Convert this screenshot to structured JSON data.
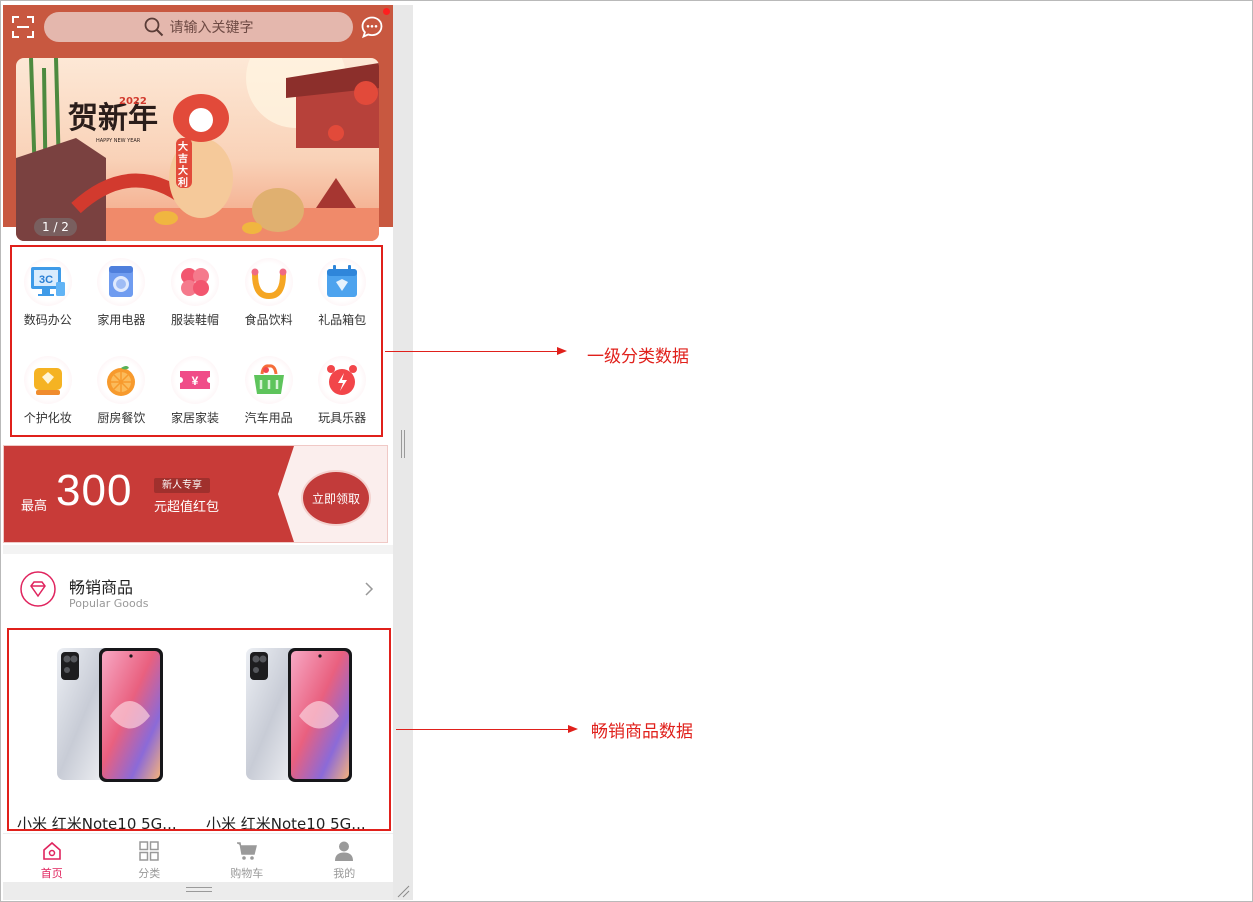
{
  "search": {
    "placeholder": "请输入关键字"
  },
  "banner": {
    "indicator": "1 / 2",
    "art_text": "贺新年",
    "year": "2022",
    "sub": "HAPPY NEW YEAR",
    "scroll": "大吉大利"
  },
  "categories": [
    {
      "label": "数码办公",
      "icon": "computer-3c-icon"
    },
    {
      "label": "家用电器",
      "icon": "washing-machine-icon"
    },
    {
      "label": "服装鞋帽",
      "icon": "clover-icon"
    },
    {
      "label": "食品饮料",
      "icon": "smile-icon"
    },
    {
      "label": "礼品箱包",
      "icon": "gift-calendar-icon"
    },
    {
      "label": "个护化妆",
      "icon": "diamond-box-icon"
    },
    {
      "label": "厨房餐饮",
      "icon": "orange-icon"
    },
    {
      "label": "家居家装",
      "icon": "ticket-icon"
    },
    {
      "label": "汽车用品",
      "icon": "basket-icon"
    },
    {
      "label": "玩具乐器",
      "icon": "alarm-clock-icon"
    }
  ],
  "promo": {
    "prefix": "最高",
    "amount": "300",
    "tag": "新人专享",
    "subtitle": "元超值红包",
    "button": "立即领取"
  },
  "section": {
    "title": "畅销商品",
    "subtitle": "Popular Goods"
  },
  "products": [
    {
      "name": "小米 红米Note10 5G..."
    },
    {
      "name": "小米 红米Note10 5G..."
    }
  ],
  "tabs": [
    {
      "label": "首页",
      "icon": "home-icon",
      "active": true
    },
    {
      "label": "分类",
      "icon": "grid-icon",
      "active": false
    },
    {
      "label": "购物车",
      "icon": "cart-icon",
      "active": false
    },
    {
      "label": "我的",
      "icon": "user-icon",
      "active": false
    }
  ],
  "annotations": {
    "category": "一级分类数据",
    "products": "畅销商品数据"
  },
  "colors": {
    "accent": "#e0245e",
    "header": "#c85840",
    "annotation": "#e0201b"
  }
}
